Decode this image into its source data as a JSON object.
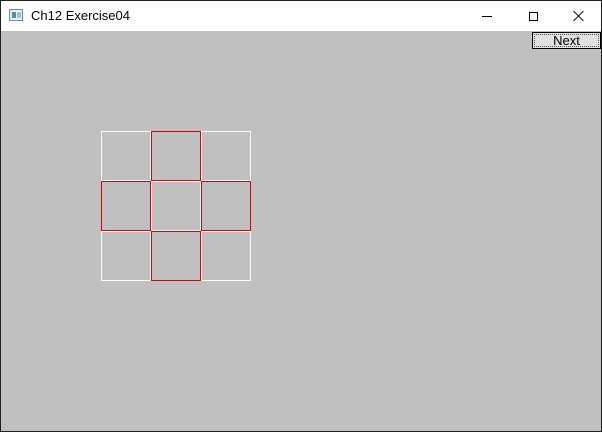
{
  "window": {
    "title": "Ch12 Exercise04",
    "icon": "app-window-icon",
    "controls": [
      "minimize",
      "maximize",
      "close"
    ]
  },
  "toolbar": {
    "next_label": "Next"
  },
  "grid": {
    "rows": 3,
    "cols": 3,
    "cells": [
      {
        "row": 0,
        "col": 0,
        "color": "#ffffff"
      },
      {
        "row": 0,
        "col": 1,
        "color": "#dd0000"
      },
      {
        "row": 0,
        "col": 2,
        "color": "#ffffff"
      },
      {
        "row": 1,
        "col": 0,
        "color": "#dd0000"
      },
      {
        "row": 1,
        "col": 1,
        "color": "#ffffff"
      },
      {
        "row": 1,
        "col": 2,
        "color": "#dd0000"
      },
      {
        "row": 2,
        "col": 0,
        "color": "#ffffff"
      },
      {
        "row": 2,
        "col": 1,
        "color": "#dd0000"
      },
      {
        "row": 2,
        "col": 2,
        "color": "#ffffff"
      }
    ]
  },
  "colors": {
    "client_background": "#c0c0c0",
    "highlight": "#dd0000",
    "default_border": "#ffffff"
  }
}
